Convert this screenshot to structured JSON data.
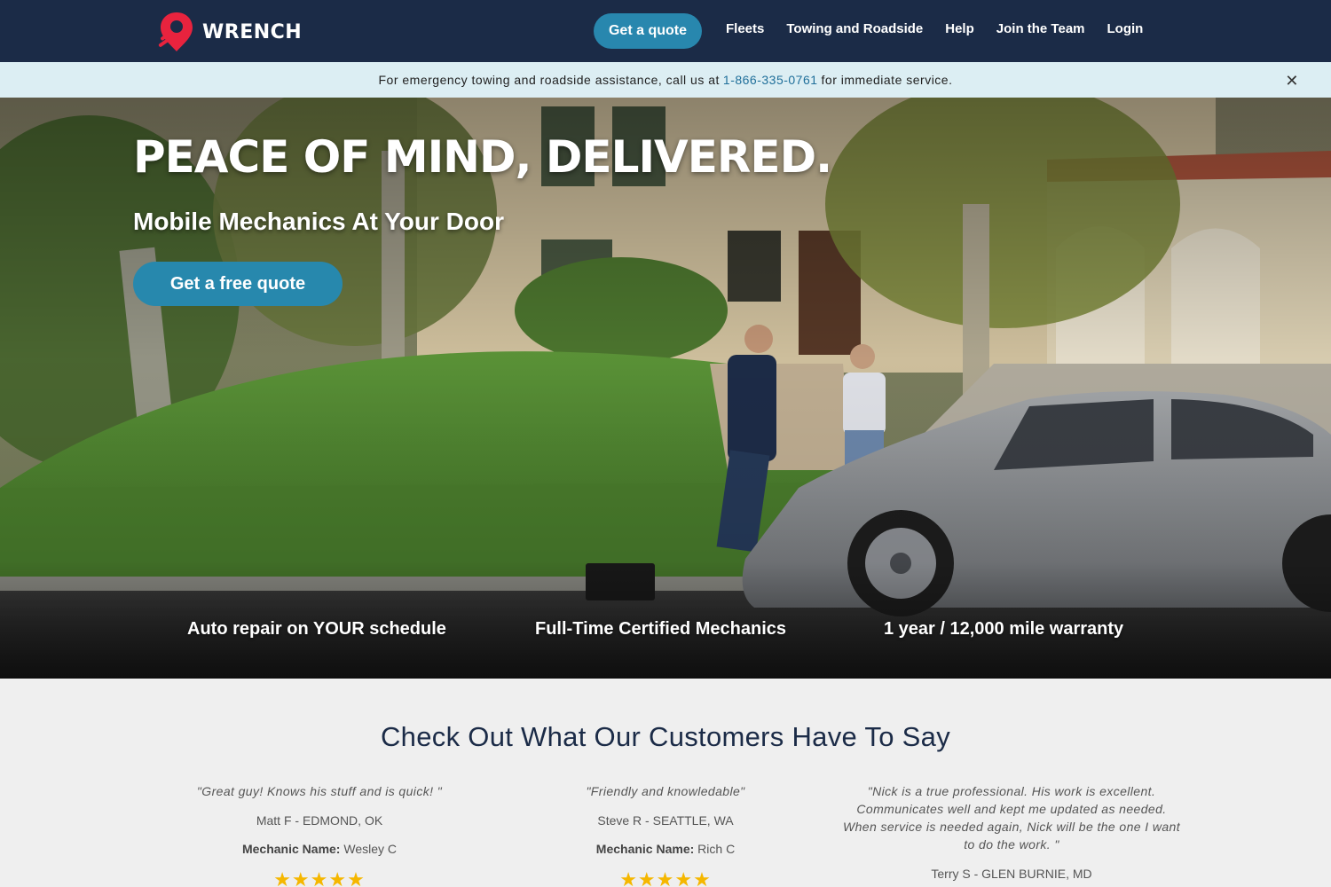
{
  "nav": {
    "brand": "WRENCH",
    "quote_button": "Get a quote",
    "links": [
      "Fleets",
      "Towing and Roadside",
      "Help",
      "Join the Team",
      "Login"
    ]
  },
  "alert": {
    "prefix": "For emergency towing and roadside assistance, call us at",
    "phone": "1-866-335-0761",
    "suffix": "for immediate service.",
    "close": "✕"
  },
  "hero": {
    "title": "PEACE OF MIND, DELIVERED.",
    "subtitle": "Mobile Mechanics At Your Door",
    "cta": "Get a free quote",
    "features": [
      "Auto repair on YOUR schedule",
      "Full-Time Certified Mechanics",
      "1 year / 12,000 mile warranty"
    ]
  },
  "reviews": {
    "title": "Check Out What Our Customers Have To Say",
    "mechanic_label": "Mechanic Name:",
    "items": [
      {
        "quote": "\"Great guy! Knows his stuff and is quick! \"",
        "name": "Matt F - EDMOND, OK",
        "mechanic": "Wesley C",
        "stars": "★★★★★"
      },
      {
        "quote": "\"Friendly and knowledable\"",
        "name": "Steve R - SEATTLE, WA",
        "mechanic": "Rich C",
        "stars": "★★★★★"
      },
      {
        "quote": "\"Nick is a true professional. His work is excellent. Communicates well and kept me updated as needed. When service is needed again, Nick will be the one I want to do the work. \"",
        "name": "Terry S - GLEN BURNIE, MD",
        "mechanic": "",
        "stars": ""
      }
    ]
  },
  "colors": {
    "nav_bg": "#1b2b47",
    "accent": "#2887ae",
    "brand_red": "#e8233e",
    "alert_bg": "#dceef3",
    "star": "#f5b700"
  }
}
